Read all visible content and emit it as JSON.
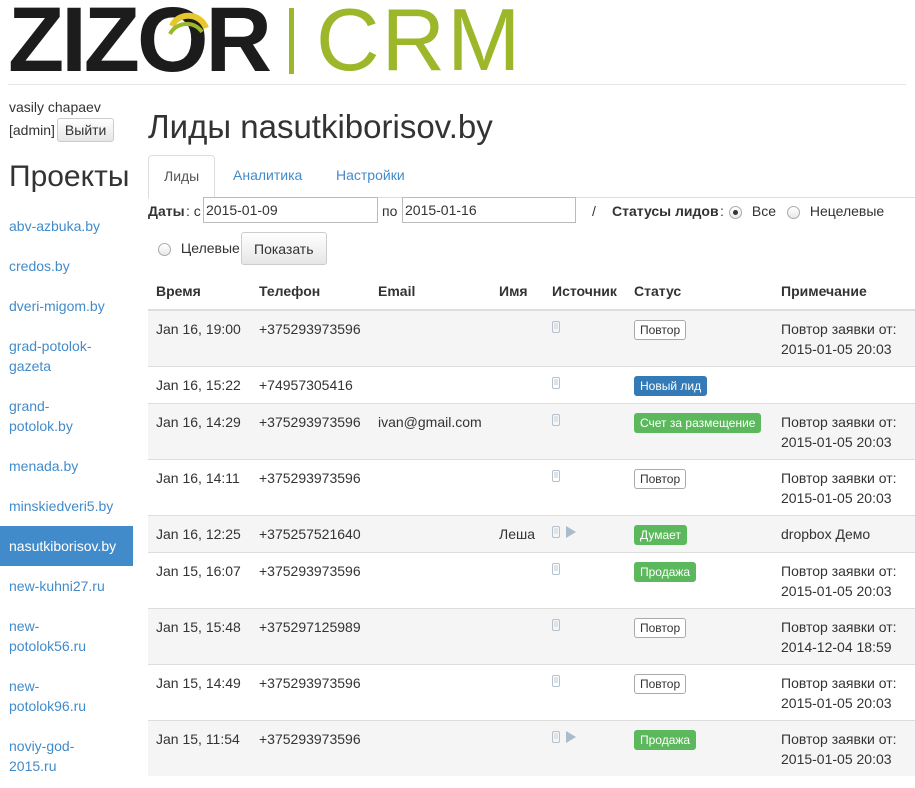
{
  "logo": {
    "zizor": "ZIZOR",
    "crm": "CRM"
  },
  "user": {
    "name": "vasily chapaev",
    "role": "[admin]",
    "logout_label": "Выйти"
  },
  "sidebar": {
    "title": "Проекты",
    "items": [
      {
        "label": "abv-azbuka.by",
        "active": false
      },
      {
        "label": "credos.by",
        "active": false
      },
      {
        "label": "dveri-migom.by",
        "active": false
      },
      {
        "label": "grad-potolok-gazeta",
        "active": false
      },
      {
        "label": "grand-potolok.by",
        "active": false
      },
      {
        "label": "menada.by",
        "active": false
      },
      {
        "label": "minskiedveri5.by",
        "active": false
      },
      {
        "label": "nasutkiborisov.by",
        "active": true
      },
      {
        "label": "new-kuhni27.ru",
        "active": false
      },
      {
        "label": "new-potolok56.ru",
        "active": false
      },
      {
        "label": "new-potolok96.ru",
        "active": false
      },
      {
        "label": "noviy-god-2015.ru",
        "active": false
      }
    ]
  },
  "page_title": "Лиды nasutkiborisov.by",
  "tabs": [
    {
      "label": "Лиды",
      "active": true
    },
    {
      "label": "Аналитика",
      "active": false
    },
    {
      "label": "Настройки",
      "active": false
    }
  ],
  "filters": {
    "dates_label": "Даты",
    "from_label": ": с",
    "from_value": "2015-01-09",
    "to_label": "по",
    "to_value": "2015-01-16",
    "separator": "/",
    "status_label": "Статусы лидов",
    "status_colon": ":",
    "options": [
      {
        "label": "Все",
        "checked": true
      },
      {
        "label": "Нецелевые",
        "checked": false
      },
      {
        "label": "Целевые",
        "checked": false
      }
    ],
    "show_label": "Показать"
  },
  "table": {
    "columns": [
      "Время",
      "Телефон",
      "Email",
      "Имя",
      "Источник",
      "Статус",
      "Примечание"
    ],
    "rows": [
      {
        "time": "Jan 16, 19:00",
        "phone": "+375293973596",
        "email": "",
        "name": "",
        "source": [
          "phone-icon"
        ],
        "status": "Повтор",
        "status_style": "default",
        "note": "Повтор заявки от: 2015-01-05 20:03"
      },
      {
        "time": "Jan 16, 15:22",
        "phone": "+74957305416",
        "email": "",
        "name": "",
        "source": [
          "phone-icon"
        ],
        "status": "Новый лид",
        "status_style": "primary",
        "note": ""
      },
      {
        "time": "Jan 16, 14:29",
        "phone": "+375293973596",
        "email": "ivan@gmail.com",
        "name": "",
        "source": [
          "phone-icon"
        ],
        "status": "Счет за размещение",
        "status_style": "success",
        "note": "Повтор заявки от: 2015-01-05 20:03"
      },
      {
        "time": "Jan 16, 14:11",
        "phone": "+375293973596",
        "email": "",
        "name": "",
        "source": [
          "phone-icon"
        ],
        "status": "Повтор",
        "status_style": "default",
        "note": "Повтор заявки от: 2015-01-05 20:03"
      },
      {
        "time": "Jan 16, 12:25",
        "phone": "+375257521640",
        "email": "",
        "name": "Леша",
        "source": [
          "phone-icon",
          "play-icon"
        ],
        "status": "Думает",
        "status_style": "success",
        "note": "dropbox Демо"
      },
      {
        "time": "Jan 15, 16:07",
        "phone": "+375293973596",
        "email": "",
        "name": "",
        "source": [
          "phone-icon"
        ],
        "status": "Продажа",
        "status_style": "success",
        "note": "Повтор заявки от: 2015-01-05 20:03"
      },
      {
        "time": "Jan 15, 15:48",
        "phone": "+375297125989",
        "email": "",
        "name": "",
        "source": [
          "phone-icon"
        ],
        "status": "Повтор",
        "status_style": "default",
        "note": "Повтор заявки от: 2014-12-04 18:59"
      },
      {
        "time": "Jan 15, 14:49",
        "phone": "+375293973596",
        "email": "",
        "name": "",
        "source": [
          "phone-icon"
        ],
        "status": "Повтор",
        "status_style": "default",
        "note": "Повтор заявки от: 2015-01-05 20:03"
      },
      {
        "time": "Jan 15, 11:54",
        "phone": "+375293973596",
        "email": "",
        "name": "",
        "source": [
          "phone-icon",
          "play-icon"
        ],
        "status": "Продажа",
        "status_style": "success",
        "note": "Повтор заявки от: 2015-01-05 20:03"
      }
    ]
  }
}
